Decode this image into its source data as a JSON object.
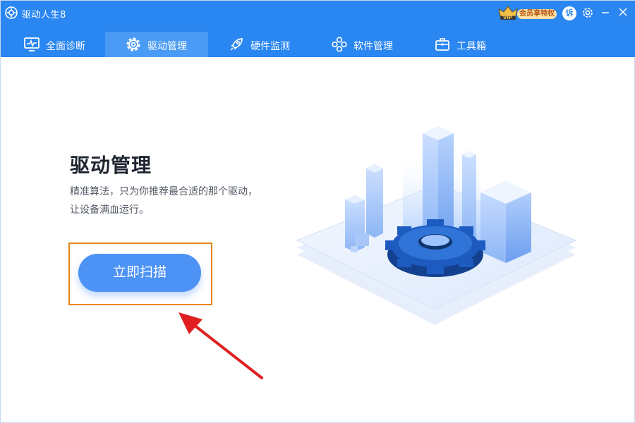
{
  "window": {
    "title": "驱动人生8",
    "vip_label": "会员享特权",
    "vip_badge": "VIP",
    "feedback_label": "诉"
  },
  "tabs": [
    {
      "label": "全面诊断",
      "icon": "monitor-icon"
    },
    {
      "label": "驱动管理",
      "icon": "gear-icon",
      "active": true
    },
    {
      "label": "硬件监测",
      "icon": "rocket-icon"
    },
    {
      "label": "软件管理",
      "icon": "apps-icon"
    },
    {
      "label": "工具箱",
      "icon": "toolbox-icon"
    }
  ],
  "main": {
    "heading": "驱动管理",
    "description_line1": "精准算法，只为你推荐最合适的那个驱动，",
    "description_line2": "让设备满血运行。",
    "scan_button": "立即扫描"
  },
  "colors": {
    "header": "#2a86f0",
    "active_tab": "#4a9bf5",
    "button": "#4d92f5",
    "highlight": "#e8841a",
    "arrow": "#e02020"
  }
}
